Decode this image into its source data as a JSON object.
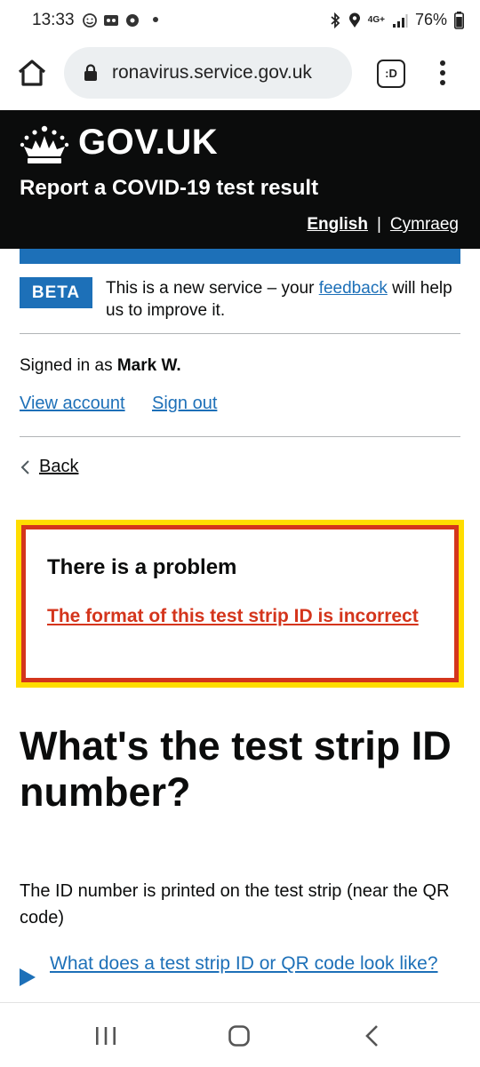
{
  "status_bar": {
    "time": "13:33",
    "battery": "76%",
    "network": "4G+",
    "icons": [
      "face-icon",
      "voicemail-icon",
      "settings-gear-icon",
      "bluetooth-icon",
      "location-icon",
      "signal-icon",
      "battery-icon"
    ]
  },
  "browser": {
    "url": "ronavirus.service.gov.uk",
    "tab_label": ":D"
  },
  "header": {
    "logo": "GOV.UK",
    "service_name": "Report a COVID-19 test result",
    "lang_active": "English",
    "lang_separator": "|",
    "lang_other": "Cymraeg"
  },
  "beta": {
    "tag": "BETA",
    "text_before": "This is a new service – your ",
    "link": "feedback",
    "text_after": " will help us to improve it."
  },
  "account": {
    "signed_in_prefix": "Signed in as ",
    "user_name": "Mark W.",
    "view_account": "View account",
    "sign_out": "Sign out"
  },
  "back": {
    "label": "Back"
  },
  "error_summary": {
    "title": "There is a problem",
    "message": "The format of this test strip ID is incorrect"
  },
  "question": {
    "heading": "What's the test strip ID number?",
    "hint": "The ID number is printed on the test strip (near the QR code)",
    "details_summary": "What does a test strip ID or QR code look like?"
  },
  "colors": {
    "header_bg": "#0b0c0c",
    "link_blue": "#1d70b8",
    "error_red": "#d4351c",
    "focus_yellow": "#ffdd00"
  }
}
